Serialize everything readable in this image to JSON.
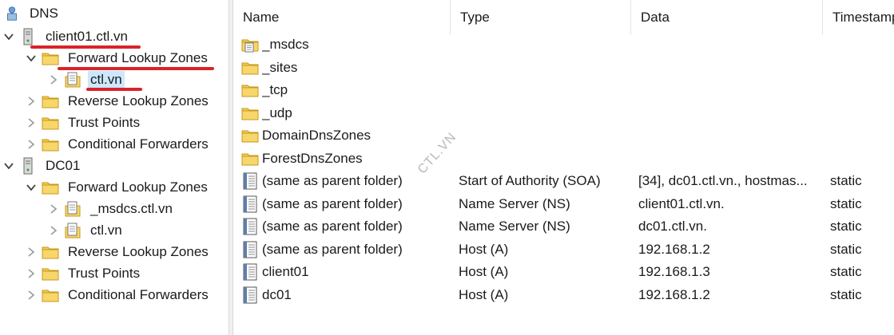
{
  "tree": {
    "root_label": "DNS",
    "servers": [
      {
        "label": "client01.ctl.vn",
        "children": [
          {
            "label": "Forward Lookup Zones",
            "children": [
              {
                "label": "ctl.vn"
              }
            ]
          },
          {
            "label": "Reverse Lookup Zones"
          },
          {
            "label": "Trust Points"
          },
          {
            "label": "Conditional Forwarders"
          }
        ]
      },
      {
        "label": "DC01",
        "children": [
          {
            "label": "Forward Lookup Zones",
            "children": [
              {
                "label": "_msdcs.ctl.vn"
              },
              {
                "label": "ctl.vn"
              }
            ]
          },
          {
            "label": "Reverse Lookup Zones"
          },
          {
            "label": "Trust Points"
          },
          {
            "label": "Conditional Forwarders"
          }
        ]
      }
    ]
  },
  "list": {
    "columns": [
      "Name",
      "Type",
      "Data",
      "Timestamp"
    ],
    "rows": [
      {
        "icon": "zone-folder-icon",
        "name": "_msdcs",
        "type": "",
        "data": "",
        "timestamp": ""
      },
      {
        "icon": "folder-icon",
        "name": "_sites",
        "type": "",
        "data": "",
        "timestamp": ""
      },
      {
        "icon": "folder-icon",
        "name": "_tcp",
        "type": "",
        "data": "",
        "timestamp": ""
      },
      {
        "icon": "folder-icon",
        "name": "_udp",
        "type": "",
        "data": "",
        "timestamp": ""
      },
      {
        "icon": "folder-icon",
        "name": "DomainDnsZones",
        "type": "",
        "data": "",
        "timestamp": ""
      },
      {
        "icon": "folder-icon",
        "name": "ForestDnsZones",
        "type": "",
        "data": "",
        "timestamp": ""
      },
      {
        "icon": "record-icon",
        "name": "(same as parent folder)",
        "type": "Start of Authority (SOA)",
        "data": "[34], dc01.ctl.vn., hostmas...",
        "timestamp": "static"
      },
      {
        "icon": "record-icon",
        "name": "(same as parent folder)",
        "type": "Name Server (NS)",
        "data": "client01.ctl.vn.",
        "timestamp": "static"
      },
      {
        "icon": "record-icon",
        "name": "(same as parent folder)",
        "type": "Name Server (NS)",
        "data": "dc01.ctl.vn.",
        "timestamp": "static"
      },
      {
        "icon": "record-icon",
        "name": "(same as parent folder)",
        "type": "Host (A)",
        "data": "192.168.1.2",
        "timestamp": "static"
      },
      {
        "icon": "record-icon",
        "name": "client01",
        "type": "Host (A)",
        "data": "192.168.1.3",
        "timestamp": "static"
      },
      {
        "icon": "record-icon",
        "name": "dc01",
        "type": "Host (A)",
        "data": "192.168.1.2",
        "timestamp": "static"
      }
    ]
  },
  "watermark": "CTL.VN",
  "colors": {
    "folder": "#f3c94f",
    "selection": "#cce8ff",
    "annotation": "#d8232a"
  }
}
